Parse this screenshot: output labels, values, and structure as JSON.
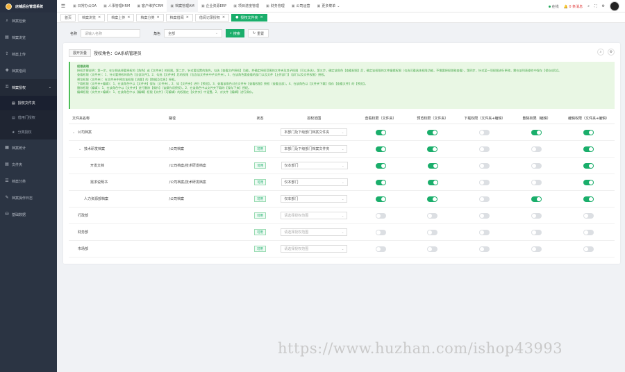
{
  "app": {
    "title": "店铺后台管理系统"
  },
  "sidebar": {
    "items": [
      {
        "label": "档案检索",
        "icon": "search-icon"
      },
      {
        "label": "档案浏览",
        "icon": "folder-icon"
      },
      {
        "label": "档案上传",
        "icon": "upload-icon"
      },
      {
        "label": "档案借阅",
        "icon": "plus-icon"
      },
      {
        "label": "档案授权",
        "icon": "lock-icon",
        "open": true
      },
      {
        "label": "档案统计",
        "icon": "chart-icon"
      },
      {
        "label": "文件夹",
        "icon": "folder-icon"
      },
      {
        "label": "档案分类",
        "icon": "list-icon"
      },
      {
        "label": "档案操作日志",
        "icon": "log-icon"
      },
      {
        "label": "基础数据",
        "icon": "database-icon"
      }
    ],
    "subitems": [
      {
        "label": "授权文件夹",
        "active": true
      },
      {
        "label": "借用门授权",
        "active": false
      },
      {
        "label": "分类授权",
        "active": false
      }
    ]
  },
  "topbar": {
    "menu": [
      {
        "label": "日常办公OA",
        "active": false
      },
      {
        "label": "人事管理HRM",
        "active": false
      },
      {
        "label": "客户维护CRM",
        "active": false
      },
      {
        "label": "档案管理AM",
        "active": true
      },
      {
        "label": "企业资源ERP",
        "active": false
      },
      {
        "label": "项目进度管理",
        "active": false
      },
      {
        "label": "财务管理",
        "active": false
      },
      {
        "label": "公司运营",
        "active": false
      },
      {
        "label": "更多菜单",
        "active": false
      }
    ],
    "status": "在线",
    "messages": "0 条消息"
  },
  "tabs": [
    {
      "label": "首页",
      "active": false
    },
    {
      "label": "档案浏览",
      "active": false
    },
    {
      "label": "档案上传",
      "active": false
    },
    {
      "label": "档案分类",
      "active": false
    },
    {
      "label": "档案借阅",
      "active": false
    },
    {
      "label": "借阅记录授权",
      "active": false
    },
    {
      "label": "授权文件夹",
      "active": true
    }
  ],
  "search": {
    "name_label": "名称",
    "name_placeholder": "请输入名称",
    "role_label": "角色",
    "role_value": "全部",
    "search_button": "搜索",
    "reset_button": "重置"
  },
  "card": {
    "expand_button": "展开折叠",
    "role_text": "授权角色：OA系统管理员"
  },
  "notice": {
    "title": "权限说明",
    "lines": [
      "授权步骤说明：第一步，在左侧选择要授权的【角色】或【文件夹】的权限。第二步，针对要设置的角色，勾选【查看文件授权】功能，并确定授权范围的文件夹及其子权限（可以多选）。第三步，确定该角色【查看权限】后，确定该权限的文件编辑权限（勾选可看具体权限功能，不需要授权即能查看）。第四步，针对某一项权限进行更改，需在该列表操作中保存【保存成功】。",
      "查看权限（文件夹）：1、针对要授权的角色【全部文件】。2、勾选【文件夹】后的权限（包含该文件夹中子文件夹）。3、在该角色要查看的部门以及文件【上传部门】（部门以及文件权限）授权。",
      "预览权限（文件夹）：在文件夹中预览该权限【流量】的【数据及信息】授权。",
      "下载权限（文件夹+编辑）：1、在该角色中以【文件夹】保存（文件夹）。2、如【文件夹】进行【预览】。3、查看该角色对应文件夹【查看权限】授权（查看全部）。4、在该角色以【文件夹下载】保存【查看文件】的【预览】。",
      "删除权限（编辑）：1、在该角色中以【文件夹】进行删除【操作】（该操作须授权）。2、在该角色中以文件夹下载的【保存下来】授权。",
      "编辑权限（文件夹+编辑）：1、在该角色中以【编辑】权限【文件】（可编辑）的权限在【文件夹】中设置。2、对文件【编辑】进行保存。"
    ]
  },
  "table": {
    "headers": {
      "name": "文件夹名称",
      "path": "路径",
      "status": "状态",
      "scope": "授权范围",
      "view": "查看权限（文件夹）",
      "preview": "预览权限（文件夹）",
      "download": "下载权限（文件夹+编辑）",
      "delete": "删除权限（编辑）",
      "edit": "编辑权限（文件夹+编辑）"
    },
    "rows": [
      {
        "name": "公司档案",
        "indent": 0,
        "caret": "⌄",
        "path": "",
        "status": "",
        "scope": "本部门及下级部门档案文件夹",
        "scope_placeholder": false,
        "sw": [
          true,
          true,
          false,
          true,
          true
        ]
      },
      {
        "name": "技术研发档案",
        "indent": 1,
        "caret": "⌄",
        "path": "/公司档案",
        "status": "可用",
        "scope": "本部门及下级部门档案文件夹",
        "scope_placeholder": false,
        "sw": [
          true,
          true,
          false,
          false,
          true
        ]
      },
      {
        "name": "开发文档",
        "indent": 2,
        "caret": "",
        "path": "/公司档案/技术研发档案",
        "status": "可用",
        "scope": "仅本部门",
        "scope_placeholder": false,
        "sw": [
          true,
          true,
          false,
          false,
          true
        ]
      },
      {
        "name": "需求说明书",
        "indent": 2,
        "caret": "",
        "path": "/公司档案/技术研发档案",
        "status": "可用",
        "scope": "仅本部门",
        "scope_placeholder": false,
        "sw": [
          true,
          true,
          false,
          false,
          true
        ]
      },
      {
        "name": "人力资源部档案",
        "indent": 1,
        "caret": "",
        "path": "/公司档案",
        "status": "可用",
        "scope": "仅本部门",
        "scope_placeholder": false,
        "sw": [
          true,
          true,
          false,
          true,
          true
        ]
      },
      {
        "name": "行政部",
        "indent": 0,
        "caret": "",
        "path": "",
        "status": "可用",
        "scope": "请选择授权范围",
        "scope_placeholder": true,
        "sw": [
          false,
          false,
          false,
          false,
          false
        ]
      },
      {
        "name": "财务部",
        "indent": 0,
        "caret": "",
        "path": "",
        "status": "可用",
        "scope": "请选择授权范围",
        "scope_placeholder": true,
        "sw": [
          false,
          false,
          false,
          false,
          false
        ]
      },
      {
        "name": "市场部",
        "indent": 0,
        "caret": "",
        "path": "",
        "status": "可用",
        "scope": "请选择授权范围",
        "scope_placeholder": true,
        "sw": [
          false,
          false,
          false,
          false,
          false
        ]
      }
    ]
  },
  "watermark": "https://www.huzhan.com/ishop43993",
  "colors": {
    "accent": "#1aae6b",
    "sidebar": "#2b3443",
    "notice_bg": "#e9f7e4"
  }
}
